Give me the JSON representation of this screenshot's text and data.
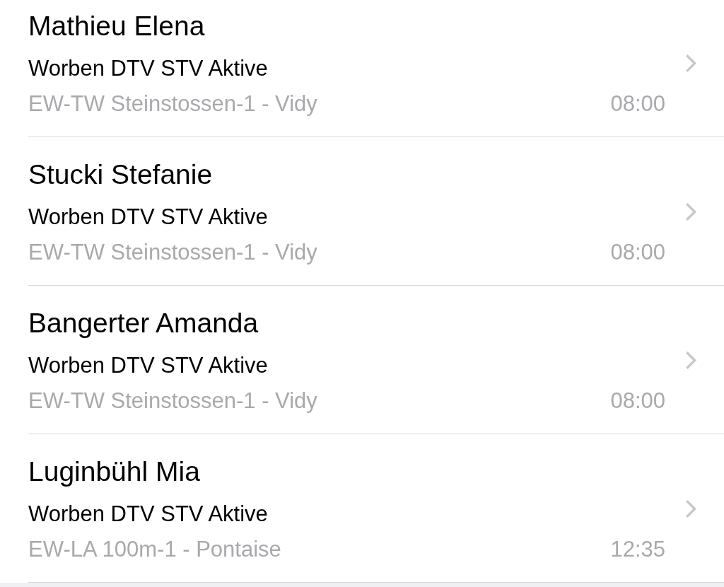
{
  "entries": [
    {
      "name": "Mathieu Elena",
      "team": "Worben DTV STV Aktive",
      "event": "EW-TW Steinstossen-1 - Vidy",
      "time": "08:00"
    },
    {
      "name": "Stucki Stefanie",
      "team": "Worben DTV STV Aktive",
      "event": "EW-TW Steinstossen-1 - Vidy",
      "time": "08:00"
    },
    {
      "name": "Bangerter Amanda",
      "team": "Worben DTV STV Aktive",
      "event": "EW-TW Steinstossen-1 - Vidy",
      "time": "08:00"
    },
    {
      "name": "Luginbühl Mia",
      "team": "Worben DTV STV Aktive",
      "event": "EW-LA 100m-1 - Pontaise",
      "time": "12:35"
    }
  ]
}
